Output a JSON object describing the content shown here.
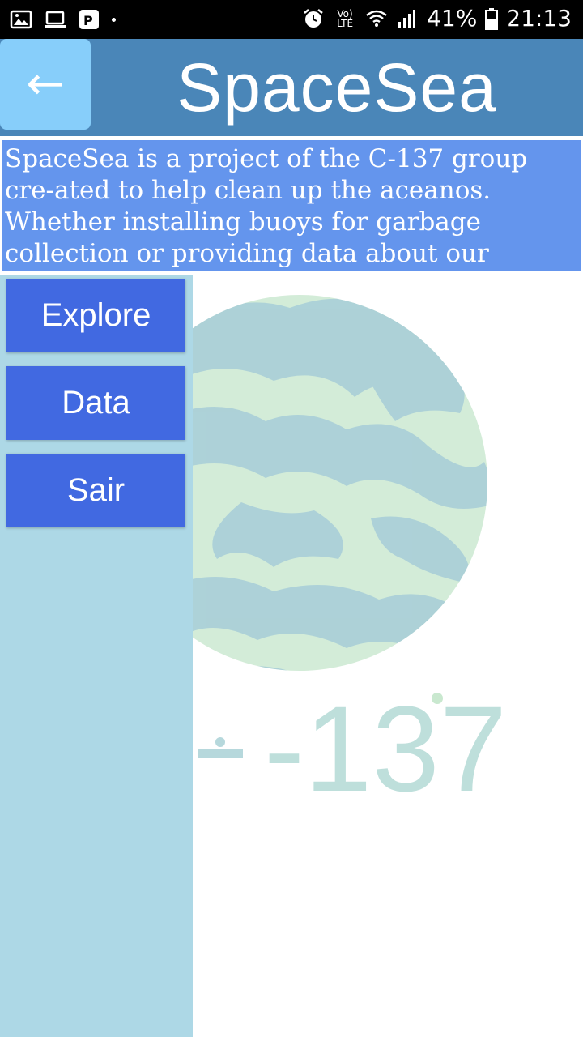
{
  "status_bar": {
    "icons": [
      "image-icon",
      "laptop-icon",
      "parking-icon",
      "alarm-icon",
      "volte-icon",
      "wifi-icon",
      "signal-icon",
      "battery-icon"
    ],
    "volte_text": "Vo) LTE",
    "battery_percent": "41%",
    "time": "21:13"
  },
  "header": {
    "back_label": "←",
    "title": "SpaceSea",
    "color": "#4a86b8",
    "back_color": "#87cefa"
  },
  "description": {
    "text": "SpaceSea is a project of the C-137 group cre-ated to help clean up the aceanos. Whether installing buoys for garbage collection or providing data about our ocean."
  },
  "menu": {
    "items": [
      {
        "label": "Explore"
      },
      {
        "label": "Data"
      },
      {
        "label": "Sair"
      }
    ],
    "button_color": "#4169e1",
    "sidebar_color": "#add8e6"
  },
  "logo": {
    "text": "-137"
  }
}
